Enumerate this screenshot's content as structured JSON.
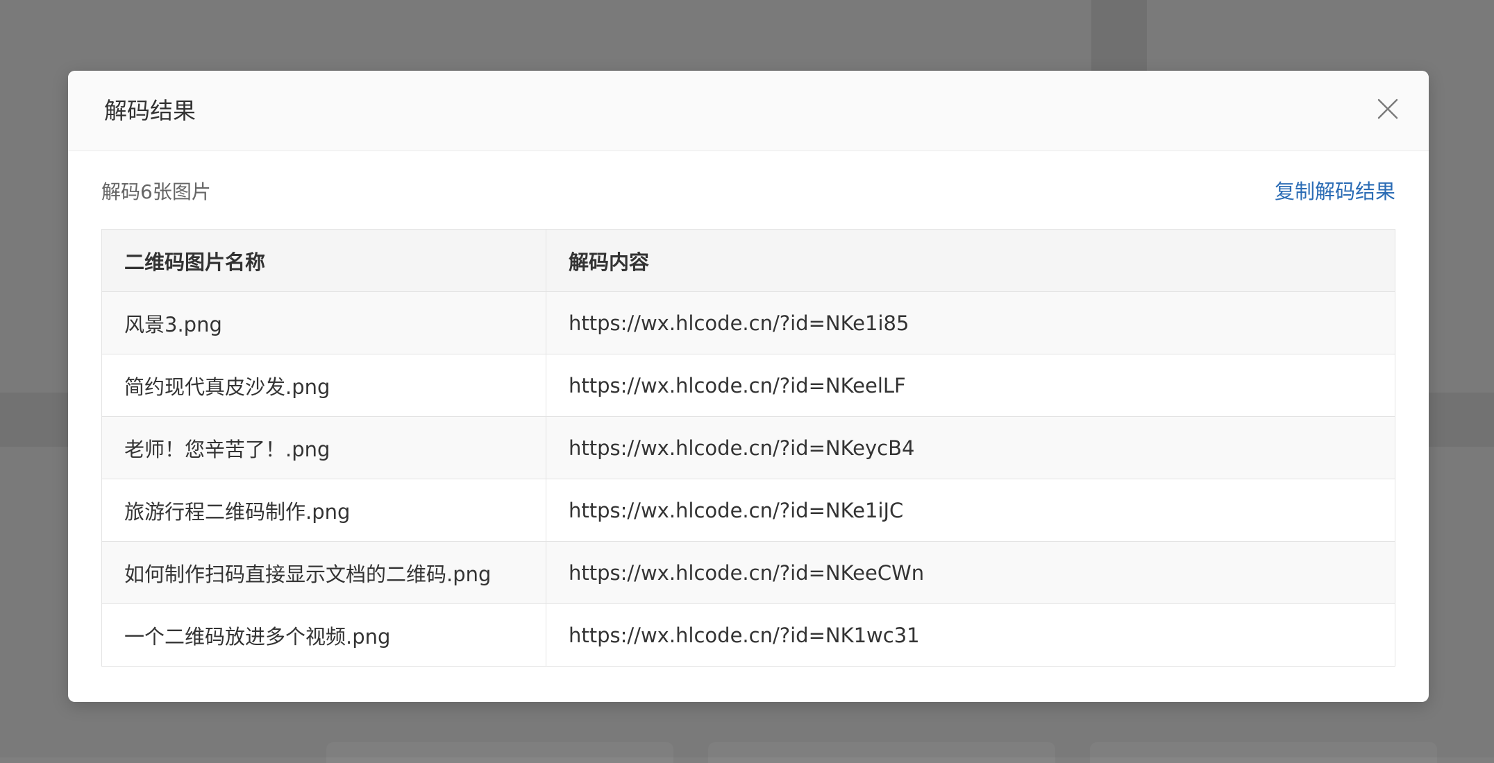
{
  "dialog": {
    "title": "解码结果",
    "close_icon": "close-icon"
  },
  "summary": {
    "text": "解码6张图片",
    "copy_label": "复制解码结果"
  },
  "table": {
    "headers": [
      "二维码图片名称",
      "解码内容"
    ],
    "rows": [
      {
        "name": "风景3.png",
        "content": "https://wx.hlcode.cn/?id=NKe1i85"
      },
      {
        "name": "简约现代真皮沙发.png",
        "content": "https://wx.hlcode.cn/?id=NKeelLF"
      },
      {
        "name": "老师！您辛苦了！.png",
        "content": "https://wx.hlcode.cn/?id=NKeycB4"
      },
      {
        "name": "旅游行程二维码制作.png",
        "content": "https://wx.hlcode.cn/?id=NKe1iJC"
      },
      {
        "name": "如何制作扫码直接显示文档的二维码.png",
        "content": "https://wx.hlcode.cn/?id=NKeeCWn"
      },
      {
        "name": "一个二维码放进多个视频.png",
        "content": "https://wx.hlcode.cn/?id=NK1wc31"
      }
    ]
  },
  "colors": {
    "link": "#2b6cb5",
    "backdrop": "#7f7f7f"
  }
}
